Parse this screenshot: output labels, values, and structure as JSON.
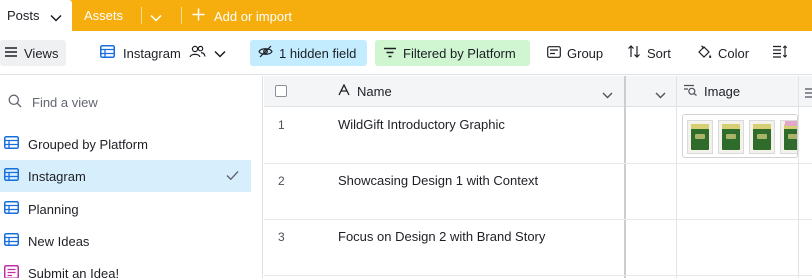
{
  "tabs": {
    "active": "Posts",
    "second": "Assets",
    "add_label": "Add or import"
  },
  "toolbar": {
    "views_label": "Views",
    "view_name": "Instagram",
    "hidden_fields": "1 hidden field",
    "filter": "Filtered by Platform",
    "group": "Group",
    "sort": "Sort",
    "color": "Color"
  },
  "sidebar": {
    "find_placeholder": "Find a view",
    "items": [
      {
        "label": "Grouped by Platform",
        "icon": "grid-view-icon",
        "active": false
      },
      {
        "label": "Instagram",
        "icon": "grid-view-icon",
        "active": true
      },
      {
        "label": "Planning",
        "icon": "grid-view-icon",
        "active": false
      },
      {
        "label": "New Ideas",
        "icon": "grid-view-icon",
        "active": false
      },
      {
        "label": "Submit an Idea!",
        "icon": "form-view-icon",
        "active": false
      }
    ]
  },
  "grid": {
    "columns": {
      "name": "Name",
      "image": "Image"
    },
    "rows": [
      {
        "num": "1",
        "name": "WildGift Introductory Graphic",
        "thumb_count": 4
      },
      {
        "num": "2",
        "name": "Showcasing Design 1 with Context",
        "thumb_count": 0
      },
      {
        "num": "3",
        "name": "Focus on Design 2 with Brand Story",
        "thumb_count": 0
      }
    ]
  },
  "colors": {
    "tab_bar": "#f5ae0e",
    "hidden_field_bg": "#c4ecff",
    "filter_bg": "#cff5d1",
    "active_view_bg": "#d7effc",
    "view_icon_blue": "#166ee1",
    "form_icon_pink": "#c12da3"
  }
}
